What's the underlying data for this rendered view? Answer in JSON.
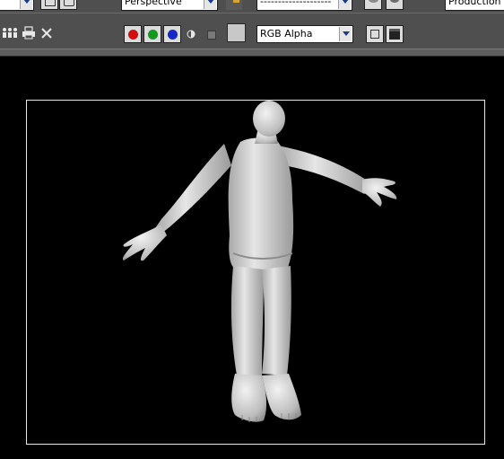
{
  "toolbar_top": {
    "viewport_value": "Perspective",
    "preset_value": "--------------------",
    "render_type_value": "Production"
  },
  "toolbar_main": {
    "channel_value": "RGB Alpha",
    "red_color": "#d21010",
    "green_color": "#109a1e",
    "blue_color": "#1428c8"
  }
}
